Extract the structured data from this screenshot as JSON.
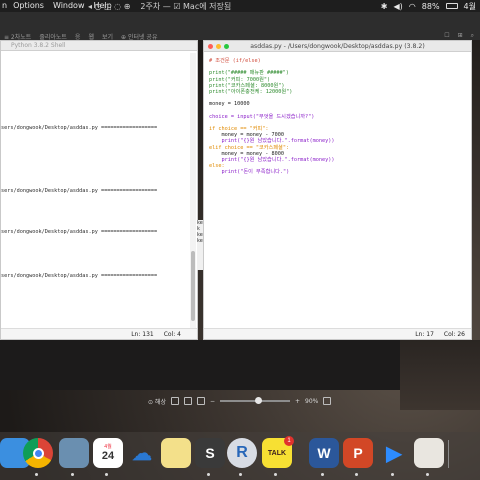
{
  "menubar": {
    "items": [
      "Options",
      "Window",
      "Help"
    ],
    "center_title": "2주차 — ☑ Mac에 저장됨",
    "battery": "88%",
    "time": "4월"
  },
  "toolbar2": {
    "left_items": [
      "≡ 2차노트",
      "줄리아노트",
      "응",
      "웹",
      "보기",
      "⊕ 인터넷 공유"
    ],
    "right_items": [
      "☐",
      "⊞",
      "⌕"
    ]
  },
  "shell": {
    "title": "Python 3.8.2 Shell",
    "restart_lines": [
      "sers/dongwook/Desktop/asddas.py ==================",
      "sers/dongwook/Desktop/asddas.py ==================",
      "sers/dongwook/Desktop/asddas.py ==================",
      "sers/dongwook/Desktop/asddas.py =================="
    ],
    "status_ln": "Ln: 131",
    "status_col": "Col: 4"
  },
  "editor": {
    "title": "asddas.py - /Users/dongwook/Desktop/asddas.py (3.8.2)",
    "code": [
      {
        "cls": "c-comment",
        "text": "# 조건문 (if/else)"
      },
      {
        "cls": "c-plain",
        "text": ""
      },
      {
        "cls": "c-str",
        "text": "print(\"##### 매뉴판 #####\")"
      },
      {
        "cls": "c-str",
        "text": "print(\"커피: 7000원\")"
      },
      {
        "cls": "c-str",
        "text": "print(\"코카스페셜: 8000원\")"
      },
      {
        "cls": "c-str",
        "text": "print(\"아이폰충전케: 12000원\")"
      },
      {
        "cls": "c-plain",
        "text": ""
      },
      {
        "cls": "c-plain",
        "text": "money = 10000"
      },
      {
        "cls": "c-plain",
        "text": ""
      },
      {
        "cls": "c-fn",
        "text": "choice = input(\"무엇을 드시겠습니까?\")"
      },
      {
        "cls": "c-plain",
        "text": ""
      },
      {
        "cls": "c-kw",
        "text": "if choice == \"커피\":"
      },
      {
        "cls": "c-plain",
        "text": "    money = money - 7000"
      },
      {
        "cls": "c-fn",
        "text": "    print(\"{}원 남았습니다.\".format(money))"
      },
      {
        "cls": "c-kw",
        "text": "elif choice == \"코카스페셜\":"
      },
      {
        "cls": "c-plain",
        "text": "    money = money - 8000"
      },
      {
        "cls": "c-fn",
        "text": "    print(\"{}원 남았습니다.\".format(money))"
      },
      {
        "cls": "c-kw",
        "text": "else:"
      },
      {
        "cls": "c-fn",
        "text": "    print(\"돈이 부족합니다.\")"
      }
    ],
    "status_ln": "Ln: 17",
    "status_col": "Col: 26"
  },
  "zoom": {
    "label_left": "⊙ 해상",
    "percent": "90%",
    "level": 0.55
  },
  "dock": {
    "apps": [
      {
        "name": "finder-icon",
        "glyph": "",
        "color": "#3b8fe0"
      },
      {
        "name": "chrome-icon",
        "glyph": "",
        "color": "#e0e0e0"
      },
      {
        "name": "preview-icon",
        "glyph": "",
        "color": "#6a8fb0"
      },
      {
        "name": "calendar-icon",
        "glyph": "24",
        "color": "#ffffff"
      },
      {
        "name": "onedrive-icon",
        "glyph": "☁",
        "color": "#2a78d2"
      },
      {
        "name": "notes-icon",
        "glyph": "",
        "color": "#f3e08a"
      },
      {
        "name": "sublime-icon",
        "glyph": "S",
        "color": "#3a3a3a"
      },
      {
        "name": "r-icon",
        "glyph": "R",
        "color": "#d8dce4"
      },
      {
        "name": "kakaotalk-icon",
        "glyph": "TALK",
        "color": "#f7e033"
      },
      {
        "name": "word-icon",
        "glyph": "W",
        "color": "#2b579a"
      },
      {
        "name": "powerpoint-icon",
        "glyph": "P",
        "color": "#d24726"
      },
      {
        "name": "zoom-icon",
        "glyph": "▶",
        "color": "#2d8cff"
      },
      {
        "name": "python-icon",
        "glyph": "",
        "color": "#e9e6e0"
      }
    ],
    "calendar_month": "4월",
    "talk_badge": "1"
  }
}
